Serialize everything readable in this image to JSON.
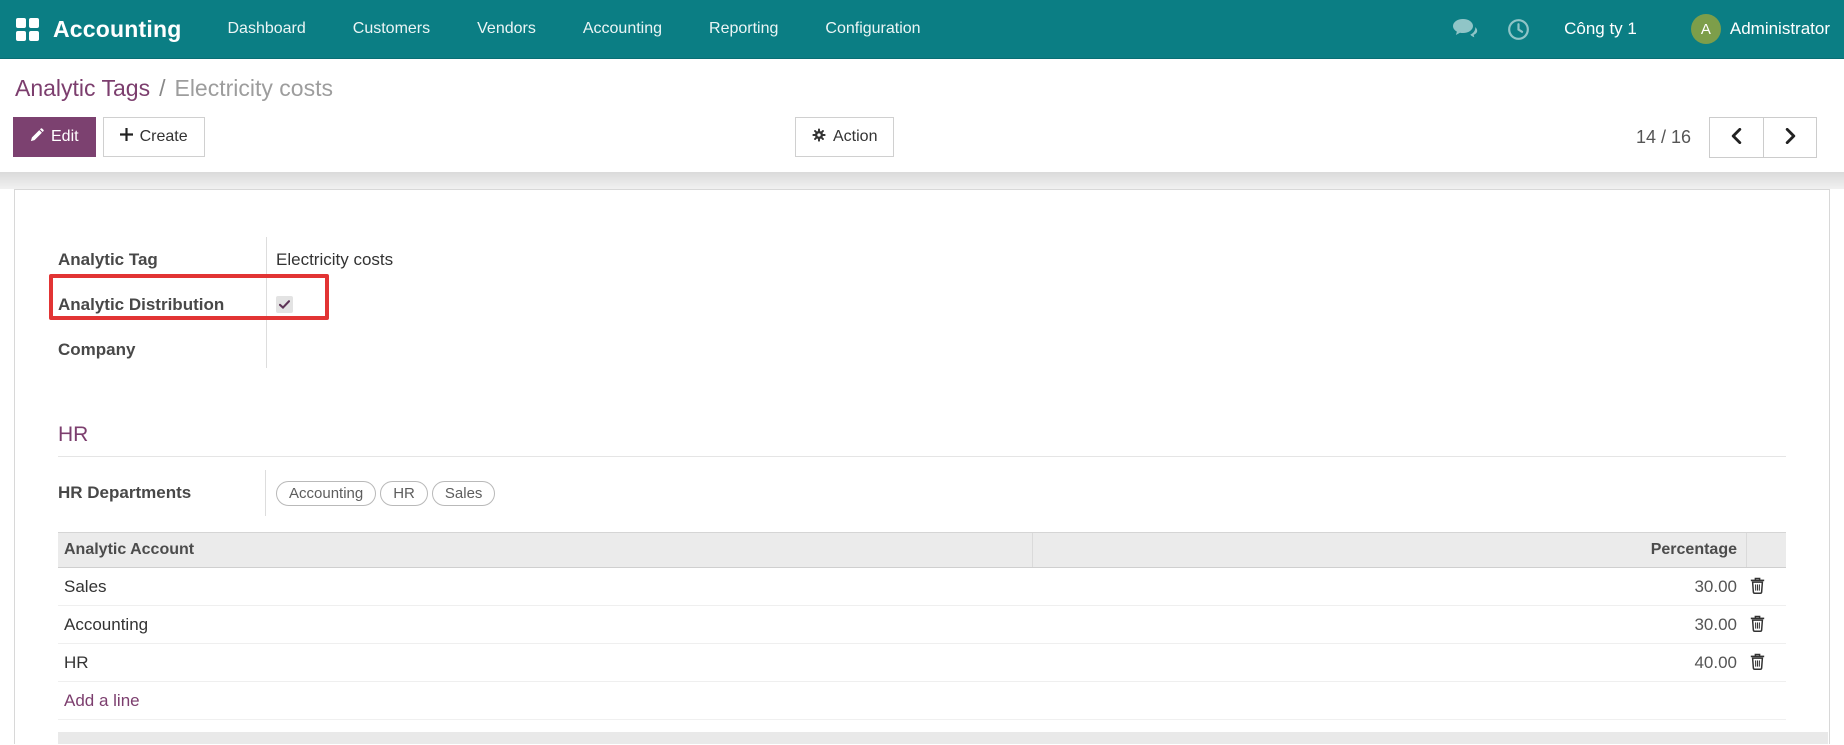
{
  "navbar": {
    "app_name": "Accounting",
    "menu_items": [
      "Dashboard",
      "Customers",
      "Vendors",
      "Accounting",
      "Reporting",
      "Configuration"
    ],
    "company": "Công ty 1",
    "user": "Administrator",
    "avatar_initial": "A"
  },
  "breadcrumb": {
    "parent": "Analytic Tags",
    "separator": "/",
    "current": "Electricity costs"
  },
  "toolbar": {
    "edit_label": "Edit",
    "create_label": "Create",
    "action_label": "Action",
    "pager_text": "14 / 16"
  },
  "form": {
    "fields": {
      "analytic_tag": {
        "label": "Analytic Tag",
        "value": "Electricity costs"
      },
      "analytic_distribution": {
        "label": "Analytic Distribution",
        "checked": true,
        "highlighted": true
      },
      "company": {
        "label": "Company",
        "value": ""
      }
    },
    "section_title": "HR",
    "hr_departments": {
      "label": "HR Departments",
      "tags": [
        "Accounting",
        "HR",
        "Sales"
      ]
    }
  },
  "table": {
    "columns": {
      "account": "Analytic Account",
      "percentage": "Percentage"
    },
    "rows": [
      {
        "account": "Sales",
        "percentage": "30.00"
      },
      {
        "account": "Accounting",
        "percentage": "30.00"
      },
      {
        "account": "HR",
        "percentage": "40.00"
      }
    ],
    "add_line_label": "Add a line"
  },
  "colors": {
    "navbar_bg": "#0b7e84",
    "primary": "#7c4170",
    "link_purple": "#7c3e6e",
    "highlight_red": "#e23434",
    "avatar_green": "#7d9e4a"
  }
}
